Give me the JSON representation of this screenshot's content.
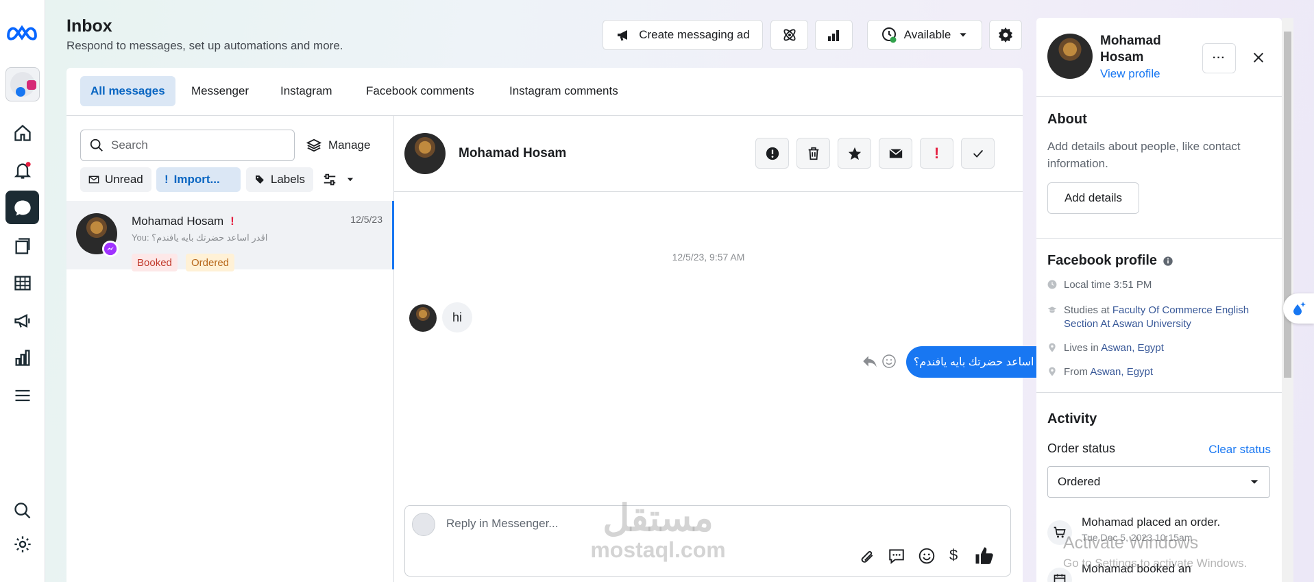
{
  "header": {
    "title": "Inbox",
    "subtitle": "Respond to messages, set up automations and more.",
    "create_ad_label": "Create messaging ad",
    "status_label": "Available"
  },
  "tabs": [
    "All messages",
    "Messenger",
    "Instagram",
    "Facebook comments",
    "Instagram comments"
  ],
  "list": {
    "search_placeholder": "Search",
    "manage_label": "Manage",
    "filters": [
      "Unread",
      "Import...",
      "Labels"
    ],
    "conversation": {
      "name": "Mohamad Hosam",
      "date": "12/5/23",
      "preview": "You: اقدر اساعد حضرتك بايه يافندم؟",
      "tags": [
        "Booked",
        "Ordered"
      ]
    }
  },
  "chat": {
    "contact_name": "Mohamad Hosam",
    "timestamp": "12/5/23, 9:57 AM",
    "incoming_message": "hi",
    "outgoing_message": "اقدر اساعد حضرتك بايه يافندم؟",
    "reply_placeholder": "Reply in Messenger..."
  },
  "profile": {
    "name": "Mohamad Hosam",
    "view_profile": "View profile",
    "about_title": "About",
    "about_text": "Add details about people, like contact information.",
    "add_details": "Add details",
    "fb_profile_title": "Facebook profile",
    "local_time": "Local time 3:51 PM",
    "studies_prefix": "Studies at ",
    "studies_at": "Faculty Of Commerce English Section At Aswan University",
    "lives_prefix": "Lives in ",
    "lives_in": "Aswan, Egypt",
    "from_prefix": "From ",
    "from": "Aswan, Egypt",
    "activity_title": "Activity",
    "order_status_label": "Order status",
    "clear_status": "Clear status",
    "order_status_value": "Ordered",
    "activity_1_title": "Mohamad placed an order.",
    "activity_1_time": "Tue Dec 5, 2023 10:15am",
    "activity_2_title": "Mohamad booked an"
  },
  "overlay": {
    "activate_title": "Activate Windows",
    "activate_sub": "Go to Settings to activate Windows.",
    "watermark_ar": "مستقل",
    "watermark_en": "mostaql.com"
  },
  "colors": {
    "accent": "#1877f2",
    "rail_active": "#1c2b33",
    "booked_bg": "#fde8e8",
    "booked_fg": "#c0392b",
    "ordered_bg": "#fff1d6",
    "ordered_fg": "#b7671a",
    "alert_red": "#e41e3f"
  }
}
